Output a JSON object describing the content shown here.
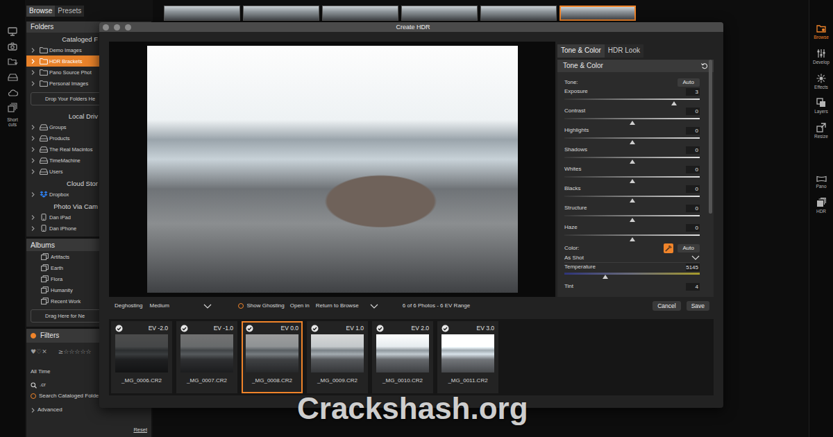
{
  "sidebar": {
    "shortcuts_label": "Short cuts",
    "view_tabs": [
      {
        "label": "Browse",
        "selected": true
      },
      {
        "label": "Presets",
        "selected": false
      }
    ],
    "folders": {
      "title": "Folders",
      "groups": [
        {
          "title": "Cataloged F",
          "items": [
            {
              "label": "Demo Images",
              "kind": "folder",
              "selected": false,
              "expanded": false
            },
            {
              "label": "HDR Brackets",
              "kind": "folder",
              "selected": true,
              "expanded": false
            },
            {
              "label": "Pano Source Phot",
              "kind": "folder",
              "selected": false,
              "expanded": false
            },
            {
              "label": "Personal Images",
              "kind": "folder",
              "selected": false,
              "expanded": false
            }
          ],
          "drop_hint": "Drop Your Folders He"
        },
        {
          "title": "Local Driv",
          "items": [
            {
              "label": "Groups",
              "kind": "drive",
              "selected": false,
              "expanded": false
            },
            {
              "label": "Products",
              "kind": "drive",
              "selected": false,
              "expanded": false
            },
            {
              "label": "The Real Macintos",
              "kind": "drive",
              "selected": false,
              "expanded": false
            },
            {
              "label": "TimeMachine",
              "kind": "drive",
              "selected": false,
              "expanded": false
            },
            {
              "label": "Users",
              "kind": "drive",
              "selected": false,
              "expanded": false
            }
          ]
        },
        {
          "title": "Cloud Stor",
          "items": [
            {
              "label": "Dropbox",
              "kind": "cloud",
              "selected": false,
              "expanded": false
            }
          ]
        },
        {
          "title": "Photo Via Cam",
          "items": [
            {
              "label": "Dan iPad",
              "kind": "device",
              "selected": false,
              "expanded": false
            },
            {
              "label": "Dan iPhone",
              "kind": "device",
              "selected": false,
              "expanded": false
            }
          ]
        }
      ]
    },
    "albums": {
      "title": "Albums",
      "items": [
        "Artifacts",
        "Earth",
        "Flora",
        "Humanity",
        "Recent Work"
      ],
      "drop_hint": "Drag Here for Ne"
    },
    "filters": {
      "title": "Filters",
      "on": true,
      "hearts": "♥♡✕",
      "stars": "≥☆☆☆☆☆",
      "date": "All Time",
      "search": ".cr",
      "search_cataloged": {
        "label": "Search Cataloged Folde",
        "checked": false
      },
      "advanced": {
        "label": "Advanced",
        "expanded": false
      },
      "reset": "Reset"
    }
  },
  "filmstrip": [
    {
      "selected": false
    },
    {
      "selected": false
    },
    {
      "selected": false
    },
    {
      "selected": false
    },
    {
      "selected": false
    },
    {
      "selected": true
    }
  ],
  "modules": [
    {
      "label": "Browse",
      "selected": true
    },
    {
      "label": "Develop",
      "selected": false
    },
    {
      "label": "Effects",
      "selected": false
    },
    {
      "label": "Layers",
      "selected": false
    },
    {
      "label": "Resize",
      "selected": false
    }
  ],
  "tools": [
    {
      "label": "Pano",
      "selected": false
    },
    {
      "label": "HDR",
      "selected": false
    }
  ],
  "dialog": {
    "title": "Create HDR",
    "tabs": [
      {
        "label": "Tone & Color",
        "selected": true
      },
      {
        "label": "HDR Look",
        "selected": false
      }
    ],
    "section": {
      "title": "Tone & Color"
    },
    "tone": {
      "label": "Tone:",
      "auto": "Auto"
    },
    "sliders": [
      {
        "name": "Exposure",
        "value": "3",
        "level": 0.81
      },
      {
        "name": "Contrast",
        "value": "0",
        "level": 0.5
      },
      {
        "name": "Highlights",
        "value": "0",
        "level": 0.5
      },
      {
        "name": "Shadows",
        "value": "0",
        "level": 0.5
      },
      {
        "name": "Whites",
        "value": "0",
        "level": 0.5
      },
      {
        "name": "Blacks",
        "value": "0",
        "level": 0.5
      },
      {
        "name": "Structure",
        "value": "0",
        "level": 0.5
      },
      {
        "name": "Haze",
        "value": "0",
        "level": 0.5
      }
    ],
    "color": {
      "label": "Color:",
      "picker_on": true,
      "auto": "Auto",
      "preset": "As Shot"
    },
    "color_sliders": [
      {
        "name": "Temperature",
        "value": "5145",
        "level": 0.3,
        "kind": "temperature"
      },
      {
        "name": "Tint",
        "value": "4",
        "kind": "tint"
      }
    ],
    "deghosting": {
      "label": "Deghosting",
      "value": "Medium"
    },
    "show_ghosting": {
      "label": "Show Ghosting",
      "checked": false
    },
    "open_in": {
      "label": "Open in",
      "value": "Return to Browse"
    },
    "summary": "6 of 6 Photos - 6 EV Range",
    "buttons": [
      {
        "label": "Cancel"
      },
      {
        "label": "Save"
      }
    ],
    "brackets": [
      {
        "ev": "EV -2.0",
        "file": "_MG_0006.CR2",
        "checked": true,
        "selected": false
      },
      {
        "ev": "EV -1.0",
        "file": "_MG_0007.CR2",
        "checked": true,
        "selected": false
      },
      {
        "ev": "EV 0.0",
        "file": "_MG_0008.CR2",
        "checked": true,
        "selected": true
      },
      {
        "ev": "EV 1.0",
        "file": "_MG_0009.CR2",
        "checked": true,
        "selected": false
      },
      {
        "ev": "EV 2.0",
        "file": "_MG_0010.CR2",
        "checked": true,
        "selected": false
      },
      {
        "ev": "EV 3.0",
        "file": "_MG_0011.CR2",
        "checked": true,
        "selected": false
      }
    ]
  },
  "watermark": "Crackshash.org"
}
